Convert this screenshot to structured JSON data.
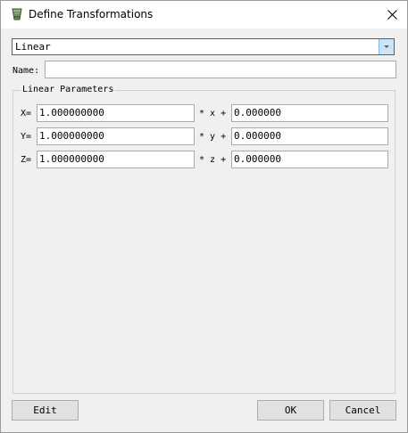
{
  "window": {
    "title": "Define Transformations"
  },
  "transform_type": {
    "value": "Linear"
  },
  "name": {
    "label": "Name:",
    "value": ""
  },
  "parameters": {
    "title": "Linear Parameters",
    "rows": [
      {
        "label": "X=",
        "coefficient": "1.000000000",
        "operator": "* x +",
        "offset": "0.000000"
      },
      {
        "label": "Y=",
        "coefficient": "1.000000000",
        "operator": "* y +",
        "offset": "0.000000"
      },
      {
        "label": "Z=",
        "coefficient": "1.000000000",
        "operator": "* z +",
        "offset": "0.000000"
      }
    ]
  },
  "buttons": {
    "edit": "Edit",
    "ok": "OK",
    "cancel": "Cancel"
  },
  "icons": {
    "app": "transform-app-icon",
    "close": "close-icon",
    "dropdown": "chevron-down-icon"
  },
  "colors": {
    "focus_border": "#0078d7",
    "dropdown_arrow_bg": "#cce4f7",
    "dialog_bg": "#f0f0f0"
  }
}
